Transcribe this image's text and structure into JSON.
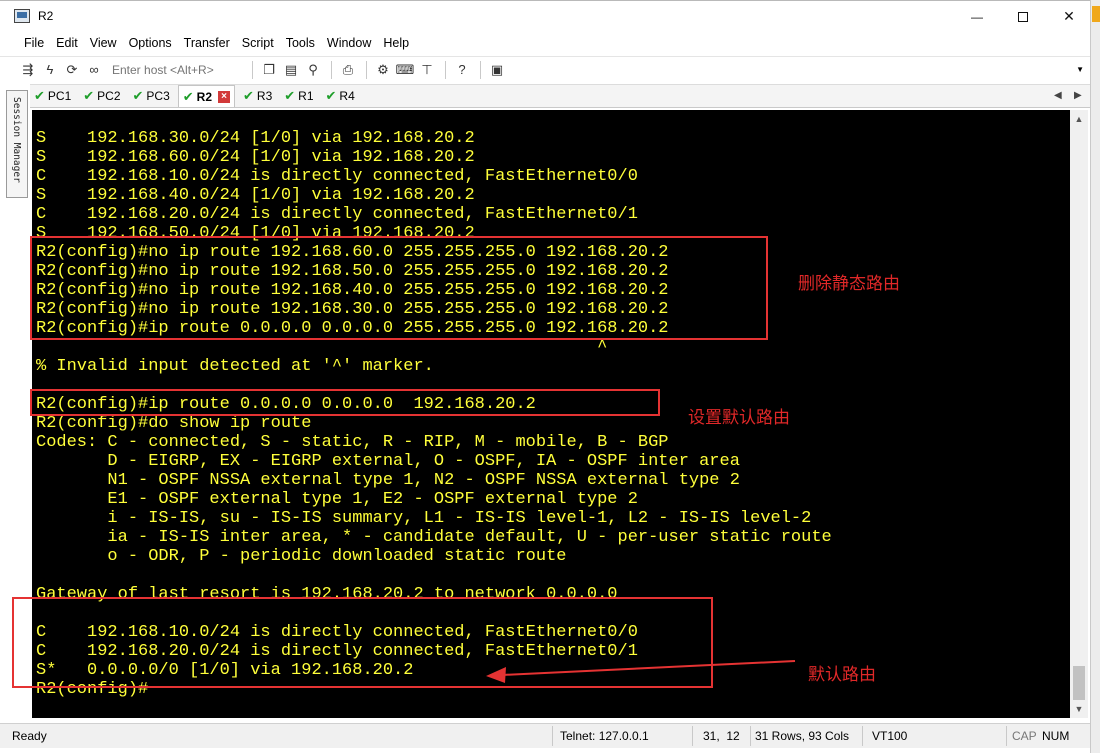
{
  "window": {
    "title": "R2",
    "minimize": "—",
    "close": "✕"
  },
  "menu": [
    "File",
    "Edit",
    "View",
    "Options",
    "Transfer",
    "Script",
    "Tools",
    "Window",
    "Help"
  ],
  "toolbar": {
    "host_placeholder": "Enter host <Alt+R>"
  },
  "tabs": [
    {
      "label": "PC1",
      "active": false
    },
    {
      "label": "PC2",
      "active": false
    },
    {
      "label": "PC3",
      "active": false
    },
    {
      "label": "R2",
      "active": true
    },
    {
      "label": "R3",
      "active": false
    },
    {
      "label": "R1",
      "active": false
    },
    {
      "label": "R4",
      "active": false
    }
  ],
  "session_manager": "Session Manager",
  "terminal": {
    "lines": [
      "S    192.168.30.0/24 [1/0] via 192.168.20.2",
      "S    192.168.60.0/24 [1/0] via 192.168.20.2",
      "C    192.168.10.0/24 is directly connected, FastEthernet0/0",
      "S    192.168.40.0/24 [1/0] via 192.168.20.2",
      "C    192.168.20.0/24 is directly connected, FastEthernet0/1",
      "S    192.168.50.0/24 [1/0] via 192.168.20.2",
      "R2(config)#no ip route 192.168.60.0 255.255.255.0 192.168.20.2",
      "R2(config)#no ip route 192.168.50.0 255.255.255.0 192.168.20.2",
      "R2(config)#no ip route 192.168.40.0 255.255.255.0 192.168.20.2",
      "R2(config)#no ip route 192.168.30.0 255.255.255.0 192.168.20.2",
      "R2(config)#ip route 0.0.0.0 0.0.0.0 255.255.255.0 192.168.20.2",
      "                                                       ^",
      "% Invalid input detected at '^' marker.",
      "",
      "R2(config)#ip route 0.0.0.0 0.0.0.0  192.168.20.2",
      "R2(config)#do show ip route",
      "Codes: C - connected, S - static, R - RIP, M - mobile, B - BGP",
      "       D - EIGRP, EX - EIGRP external, O - OSPF, IA - OSPF inter area",
      "       N1 - OSPF NSSA external type 1, N2 - OSPF NSSA external type 2",
      "       E1 - OSPF external type 1, E2 - OSPF external type 2",
      "       i - IS-IS, su - IS-IS summary, L1 - IS-IS level-1, L2 - IS-IS level-2",
      "       ia - IS-IS inter area, * - candidate default, U - per-user static route",
      "       o - ODR, P - periodic downloaded static route",
      "",
      "Gateway of last resort is 192.168.20.2 to network 0.0.0.0",
      "",
      "C    192.168.10.0/24 is directly connected, FastEthernet0/0",
      "C    192.168.20.0/24 is directly connected, FastEthernet0/1",
      "S*   0.0.0.0/0 [1/0] via 192.168.20.2",
      "R2(config)#"
    ]
  },
  "annotations": {
    "delete_static": "删除静态路由",
    "set_default": "设置默认路由",
    "default_route": "默认路由",
    "color": "#e53333"
  },
  "status": {
    "ready": "Ready",
    "telnet": "Telnet: 127.0.0.1",
    "cursor": "31,  12",
    "size": "31 Rows, 93 Cols",
    "emulation": "VT100",
    "cap": "CAP",
    "num": "NUM"
  },
  "colors": {
    "terminal_bg": "#000000",
    "terminal_fg": "#ffff3a",
    "check": "#1e9e2a"
  }
}
